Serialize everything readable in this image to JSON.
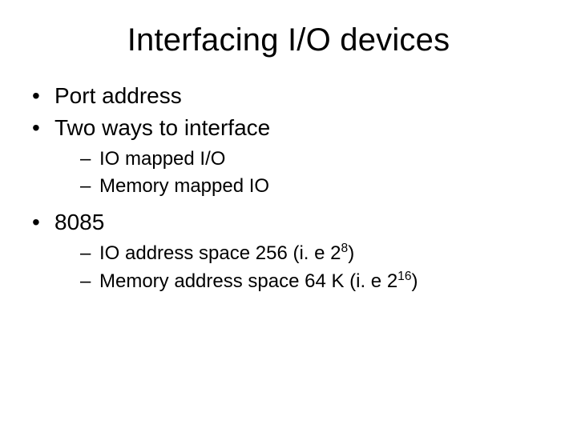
{
  "title": "Interfacing I/O devices",
  "bullets": {
    "b1": "Port address",
    "b2": "Two ways to interface",
    "b2_sub1": "IO mapped I/O",
    "b2_sub2": "Memory mapped IO",
    "b3": "8085",
    "b3_sub1_pre": "IO address space 256 (i. e 2",
    "b3_sub1_sup": "8",
    "b3_sub1_post": ")",
    "b3_sub2_pre": "Memory address space 64 K (i. e 2",
    "b3_sub2_sup": "16",
    "b3_sub2_post": ")"
  }
}
